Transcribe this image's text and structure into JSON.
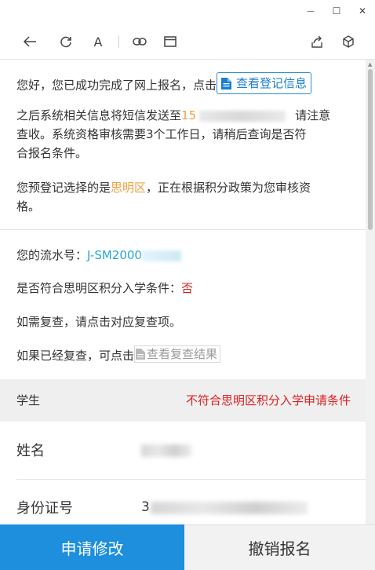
{
  "window": {
    "minimize_glyph": "—",
    "maximize_glyph": "☐",
    "close_glyph": "✕"
  },
  "toolbar": {
    "font_label": "A"
  },
  "notice": {
    "line1_prefix": "您好，您已成功完成了网上报名，点击",
    "view_info_button": "查看登记信息",
    "line2_prefix": "之后系统相关信息将短信发送至",
    "phone_visible": "15",
    "line2_suffix": "请注意",
    "line3": "查收。系统资格审核需要3个工作日，请稍后查询是否符",
    "line4": "合报名条件。",
    "district_prefix": "您预登记选择的是",
    "district_name": "思明区",
    "district_suffix": "，正在根据积分政策为您审核资",
    "district_line2": "格。"
  },
  "status": {
    "serial_label": "您的流水号：",
    "serial_visible": "J-SM2000",
    "eligible_label": "是否符合思明区积分入学条件：",
    "eligible_value": "否",
    "recheck_hint": "如需复查，请点击对应复查项。",
    "result_prefix": "如果已经复查，可点击",
    "result_link": "查看复查结果"
  },
  "student": {
    "label": "学生",
    "status": "不符合思明区积分入学申请条件",
    "name_label": "姓名",
    "id_label": "身份证号",
    "id_visible": "3"
  },
  "actions": {
    "apply_modify": "申请修改",
    "cancel_registration": "撤销报名"
  },
  "colors": {
    "primary": "#1e8fdc",
    "district": "#f0a040",
    "serial": "#23a6dc",
    "negative": "#e02020"
  }
}
